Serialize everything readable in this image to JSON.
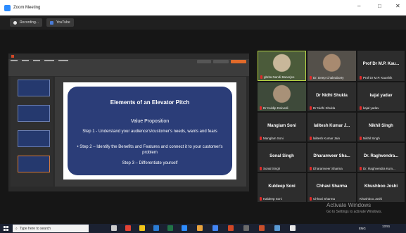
{
  "window": {
    "title": "Zoom Meeting",
    "minimize": "–",
    "maximize": "□",
    "close": "✕"
  },
  "toolbar": {
    "recording_label": "Recording...",
    "youtube_label": "YouTube"
  },
  "slide": {
    "title": "Elements of an Elevator Pitch",
    "subtitle": "Value Proposition",
    "step1": "Step 1 - Understand your audience's/customer's needs, wants and fears",
    "step2": "• Step 2 – Identify the Benefits and Features and connect it to your customer's problem",
    "step3": "Step 3 – Differentiate yourself"
  },
  "participants": [
    {
      "name": "",
      "label": "gbrita Nandi Banerjee",
      "video": true
    },
    {
      "name": "",
      "label": "Dr. Deep Chakraborty",
      "video": true
    },
    {
      "name": "Prof Dr M.P. Kau...",
      "label": "Prof Dr M.P. Kaushik",
      "video": false
    },
    {
      "name": "",
      "label": "Dr Kuldip Dwivedi",
      "video": true
    },
    {
      "name": "Dr Nidhi Shukla",
      "label": "Dr Nidhi Shukla",
      "video": false
    },
    {
      "name": "kajal yadav",
      "label": "kajal yadav",
      "video": false
    },
    {
      "name": "Manglam Soni",
      "label": "Manglam Soni",
      "video": false
    },
    {
      "name": "lalitesh Kumar J...",
      "label": "lalitesh Kumar Jain",
      "video": false
    },
    {
      "name": "Nikhil Singh",
      "label": "Nikhil Singh",
      "video": false
    },
    {
      "name": "Sonal Singh",
      "label": "Sonal Singh",
      "video": false
    },
    {
      "name": "Dharamveer Sha...",
      "label": "Dharamveer Sharma",
      "video": false
    },
    {
      "name": "Dr. Raghvendra...",
      "label": "Dr. Raghvendra Kum...",
      "video": false
    },
    {
      "name": "Kuldeep Soni",
      "label": "Kaldeep Soni",
      "video": false
    },
    {
      "name": "Chhavi Sharma",
      "label": "Chhavi Sharma",
      "video": false
    },
    {
      "name": "Khushboo Joshi",
      "label": "Khushboo Joshi",
      "video": false
    }
  ],
  "watermark": {
    "line1": "Activate Windows",
    "line2": "Go to Settings to activate Windows."
  },
  "taskbar": {
    "search_placeholder": "Type here to search",
    "time": "13:51",
    "lang": "ENG"
  },
  "colors": {
    "slide_bg": "#2b3d78",
    "active_border": "#b8d645",
    "zoom_blue": "#2d8cff"
  }
}
